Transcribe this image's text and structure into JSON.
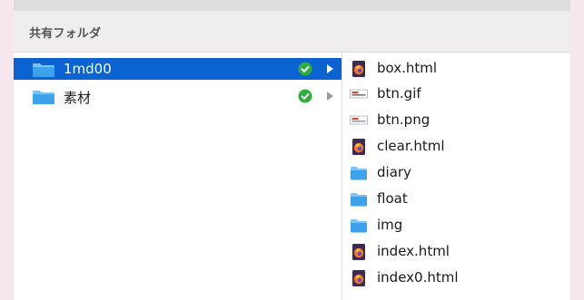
{
  "finder": {
    "section_title": "共有フォルダ",
    "left_column": [
      {
        "label": "1md00",
        "selected": true,
        "status_icon": "check-circle-icon",
        "has_children": true
      },
      {
        "label": "素材",
        "selected": false,
        "status_icon": "check-circle-icon",
        "has_children": true
      }
    ],
    "right_column": [
      {
        "label": "box.html",
        "icon": "firefox-html-file-icon"
      },
      {
        "label": "btn.gif",
        "icon": "image-file-icon"
      },
      {
        "label": "btn.png",
        "icon": "image-file-icon"
      },
      {
        "label": "clear.html",
        "icon": "firefox-html-file-icon"
      },
      {
        "label": "diary",
        "icon": "folder-icon"
      },
      {
        "label": "float",
        "icon": "folder-icon"
      },
      {
        "label": "img",
        "icon": "folder-icon"
      },
      {
        "label": "index.html",
        "icon": "firefox-html-file-icon"
      },
      {
        "label": "index0.html",
        "icon": "firefox-html-file-icon"
      }
    ]
  },
  "colors": {
    "selection": "#0a63d0",
    "folder": "#3ca2ea",
    "check_badge": "#2fae3f",
    "background_right": "#f6e7ee"
  }
}
